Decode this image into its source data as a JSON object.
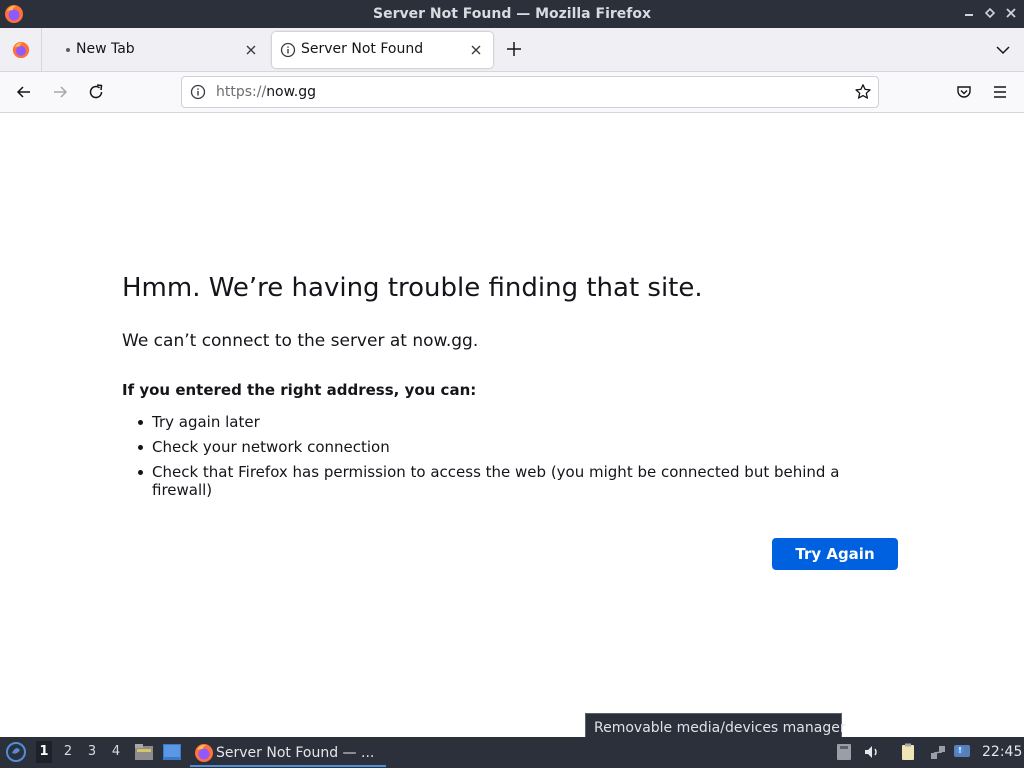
{
  "window": {
    "title": "Server Not Found — Mozilla Firefox"
  },
  "tabs": [
    {
      "label": "New Tab",
      "active": false
    },
    {
      "label": "Server Not Found",
      "active": true
    }
  ],
  "navbar": {
    "url_scheme": "https://",
    "url_host": "now.gg"
  },
  "error_page": {
    "title": "Hmm. We’re having trouble finding that site.",
    "description": "We can’t connect to the server at now.gg.",
    "suggestions_heading": "If you entered the right address, you can:",
    "suggestions": [
      "Try again later",
      "Check your network connection",
      "Check that Firefox has permission to access the web (you might be connected but behind a firewall)"
    ],
    "try_again_label": "Try Again"
  },
  "tooltip": {
    "text": "Removable media/devices manager"
  },
  "taskbar": {
    "workspaces": [
      "1",
      "2",
      "3",
      "4"
    ],
    "active_workspace": "1",
    "task_label": "Server Not Found — ...",
    "clock": "22:45"
  },
  "colors": {
    "titlebar_bg": "#2b303b",
    "accent_button": "#0061e0",
    "taskbar_bg": "#2b303b"
  },
  "icons": {
    "app": "firefox-icon",
    "back": "back-arrow-icon",
    "forward": "forward-arrow-icon",
    "reload": "reload-icon",
    "site_info": "info-icon",
    "bookmark": "star-icon",
    "pocket": "pocket-icon",
    "menu": "hamburger-menu-icon"
  }
}
